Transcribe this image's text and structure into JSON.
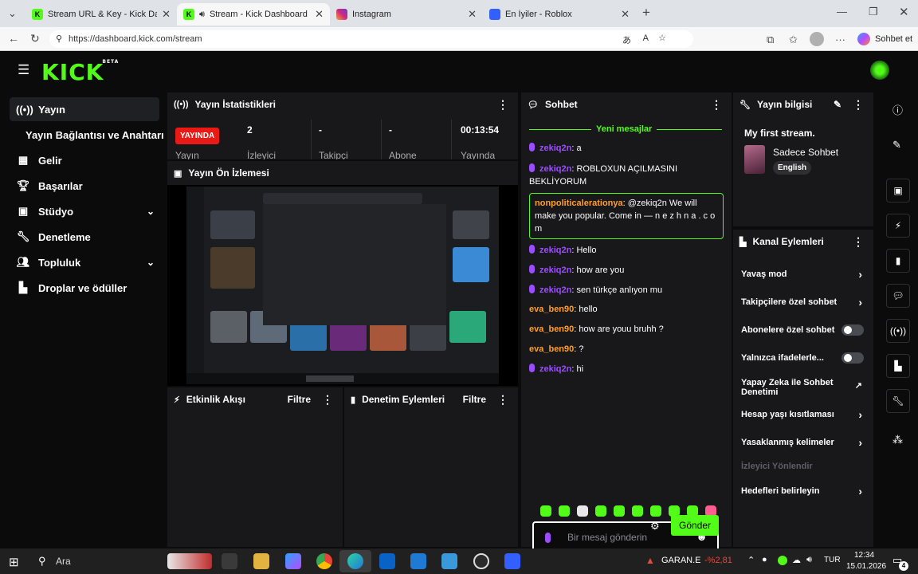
{
  "browser": {
    "tabs": [
      {
        "title": "Stream URL & Key - Kick Dashboar",
        "icon": "kick-icon"
      },
      {
        "title": "Stream - Kick Dashboard",
        "icon": "kick-icon"
      },
      {
        "title": "Instagram",
        "icon": "instagram-icon"
      },
      {
        "title": "En İyiler - Roblox",
        "icon": "roblox-icon"
      }
    ],
    "url": "https://dashboard.kick.com/stream",
    "copilot_label": "Sohbet et"
  },
  "app": {
    "logo": "KICK",
    "logo_sup": "BETA",
    "accent": "#53fc18"
  },
  "sidebar": {
    "items": [
      {
        "label": "Yayın",
        "icon": "broadcast-icon"
      },
      {
        "label": "Yayın Bağlantısı ve Anahtarı",
        "icon": ""
      },
      {
        "label": "Gelir",
        "icon": "revenue-icon"
      },
      {
        "label": "Başarılar",
        "icon": "trophy-icon"
      },
      {
        "label": "Stüdyo",
        "icon": "studio-icon"
      },
      {
        "label": "Denetleme",
        "icon": "wrench-icon"
      },
      {
        "label": "Topluluk",
        "icon": "community-icon"
      },
      {
        "label": "Droplar ve ödüller",
        "icon": "drops-icon"
      }
    ]
  },
  "stats": {
    "title": "Yayın İstatistikleri",
    "live_badge": "YAYINDA",
    "live_label": "Yayın",
    "viewers_value": "2",
    "viewers_label": "İzleyici",
    "followers_value": "-",
    "followers_label": "Takipçi",
    "subs_value": "-",
    "subs_label": "Abone",
    "uptime_value": "00:13:54",
    "uptime_label": "Yayında"
  },
  "preview": {
    "title": "Yayın Ön İzlemesi"
  },
  "activity": {
    "title": "Etkinlik Akışı",
    "filter": "Filtre"
  },
  "modlog": {
    "title": "Denetim Eylemleri",
    "filter": "Filtre"
  },
  "chat": {
    "title": "Sohbet",
    "new_messages": "Yeni mesajlar",
    "messages": [
      {
        "user": "zekiq2n",
        "text": ": a",
        "color": "#9c4dff"
      },
      {
        "user": "zekiq2n",
        "text": ": ROBLOXUN AÇILMASINI BEKLİYORUM",
        "color": "#9c4dff"
      },
      {
        "user": "nonpoliticalerationya",
        "text": ": @zekiq2n We will make you popular. Come in — n e z h n a . c o m",
        "color": "#ff9e2c"
      },
      {
        "user": "zekiq2n",
        "text": ": Hello",
        "color": "#9c4dff"
      },
      {
        "user": "zekiq2n",
        "text": ": how are you",
        "color": "#9c4dff"
      },
      {
        "user": "zekiq2n",
        "text": ": sen türkçe anlıyon mu",
        "color": "#9c4dff"
      },
      {
        "user": "eva_ben90",
        "text": ": hello",
        "color": "#ff9e2c"
      },
      {
        "user": "eva_ben90",
        "text": ": how are youu bruhh ?",
        "color": "#ff9e2c"
      },
      {
        "user": "eva_ben90",
        "text": ": ?",
        "color": "#ff9e2c"
      },
      {
        "user": "zekiq2n",
        "text": ": hi",
        "color": "#9c4dff"
      }
    ],
    "placeholder": "Bir mesaj gönderin",
    "send": "Gönder"
  },
  "info": {
    "title": "Yayın bilgisi",
    "stream_title": "My first stream.",
    "category": "Sadece Sohbet",
    "language": "English"
  },
  "actions": {
    "title": "Kanal Eylemleri",
    "items": [
      {
        "label": "Yavaş mod",
        "control": "arrow"
      },
      {
        "label": "Takipçilere özel sohbet",
        "control": "arrow"
      },
      {
        "label": "Abonelere özel sohbet",
        "control": "toggle"
      },
      {
        "label": "Yalnızca ifadelerle...",
        "control": "toggle"
      },
      {
        "label": "Yapay Zeka ile Sohbet Denetimi",
        "control": "external"
      },
      {
        "label": "Hesap yaşı kısıtlaması",
        "control": "arrow"
      },
      {
        "label": "Yasaklanmış kelimeler",
        "control": "arrow"
      },
      {
        "label": "İzleyici Yönlendir",
        "control": "none"
      },
      {
        "label": "Hedefleri belirleyin",
        "control": "arrow"
      }
    ]
  },
  "taskbar": {
    "search": "Ara",
    "ticker": "GARAN.E",
    "ticker_change": "-%2,81",
    "lang": "TUR",
    "time": "12:34",
    "date": "15.01.2026",
    "notif": "4"
  }
}
